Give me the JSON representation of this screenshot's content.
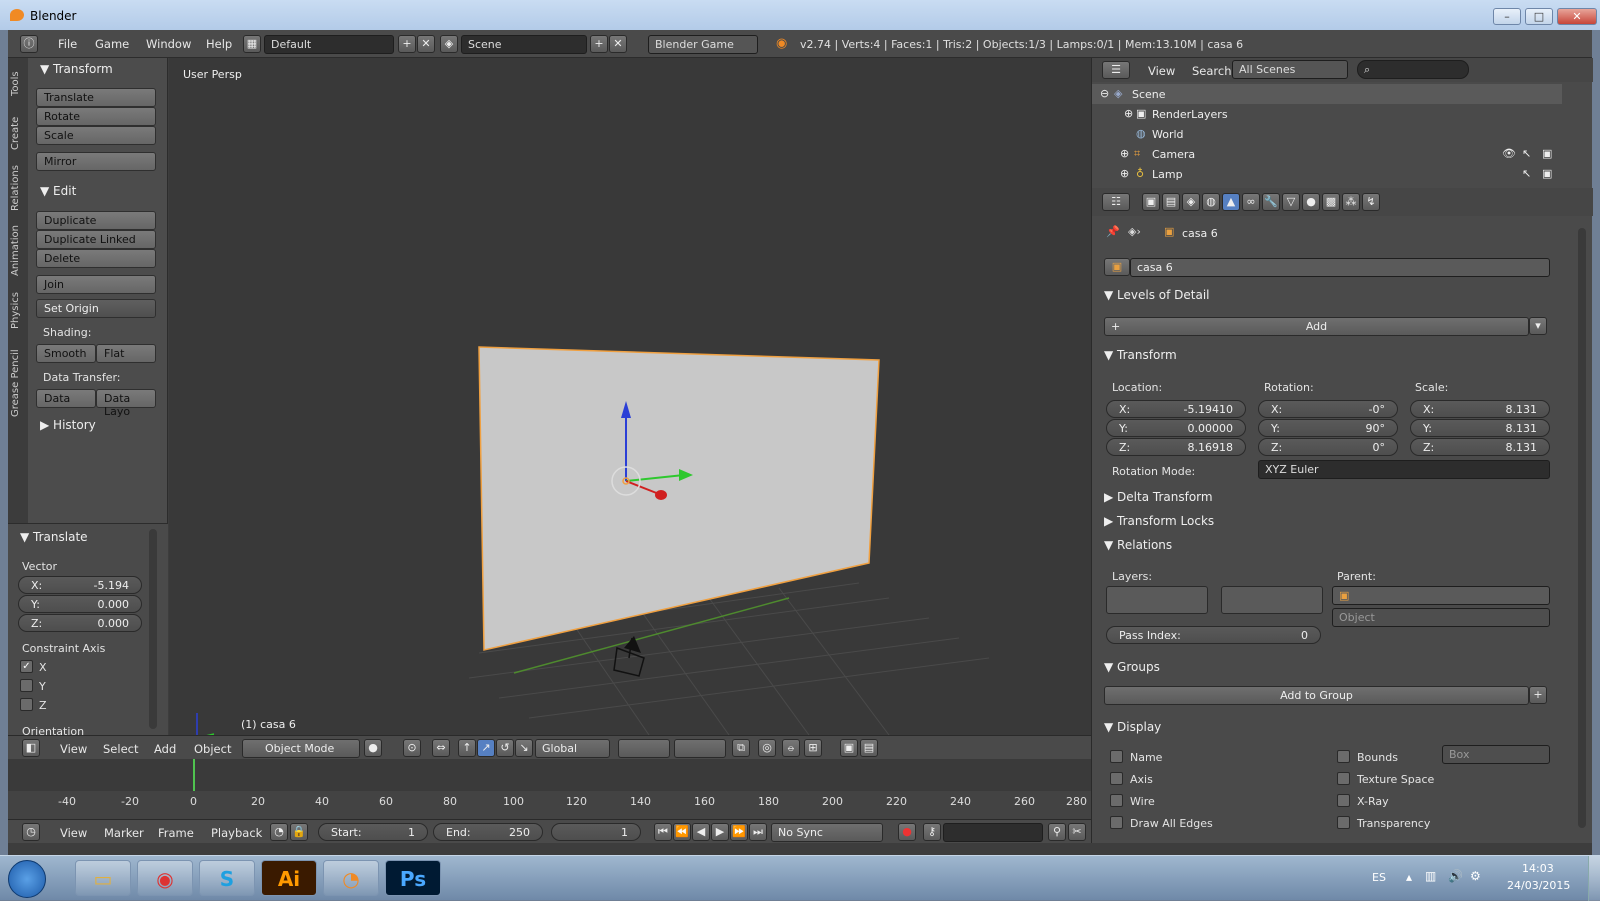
{
  "window": {
    "title": "Blender",
    "minimize": "–",
    "maximize": "□",
    "close": "✕"
  },
  "topbar": {
    "menus": [
      "File",
      "Game",
      "Window",
      "Help"
    ],
    "layout": "Default",
    "scene": "Scene",
    "engine": "Blender Game",
    "stats": "v2.74 | Verts:4 | Faces:1 | Tris:2 | Objects:1/3 | Lamps:0/1 | Mem:13.10M | casa 6"
  },
  "toolshelf": {
    "tabs": [
      "Tools",
      "Create",
      "Relations",
      "Animation",
      "Physics",
      "Grease Pencil"
    ],
    "transform_title": "Transform",
    "transform_buttons": [
      "Translate",
      "Rotate",
      "Scale"
    ],
    "mirror": "Mirror",
    "edit_title": "Edit",
    "edit_buttons": [
      "Duplicate",
      "Duplicate Linked",
      "Delete"
    ],
    "join": "Join",
    "set_origin": "Set Origin",
    "shading_label": "Shading:",
    "smooth": "Smooth",
    "flat": "Flat",
    "data_transfer_label": "Data Transfer:",
    "data": "Data",
    "data_layo": "Data Layo",
    "history_title": "History"
  },
  "operator": {
    "title": "Translate",
    "vector_label": "Vector",
    "x": "X:",
    "x_val": "-5.194",
    "y": "Y:",
    "y_val": "0.000",
    "z": "Z:",
    "z_val": "0.000",
    "constraint_label": "Constraint Axis",
    "cx": "X",
    "cy": "Y",
    "cz": "Z",
    "orientation_label": "Orientation"
  },
  "viewport": {
    "view_name": "User Persp",
    "object_label": "(1) casa 6"
  },
  "vpheader": {
    "menus": [
      "View",
      "Select",
      "Add",
      "Object"
    ],
    "mode": "Object Mode",
    "orientation": "Global"
  },
  "timeline": {
    "ticks": [
      "-40",
      "-20",
      "0",
      "20",
      "40",
      "60",
      "80",
      "100",
      "120",
      "140",
      "160",
      "180",
      "200",
      "220",
      "240",
      "260",
      "280"
    ],
    "menus": [
      "View",
      "Marker",
      "Frame",
      "Playback"
    ],
    "start_label": "Start:",
    "start": "1",
    "end_label": "End:",
    "end": "250",
    "current": "1",
    "sync": "No Sync"
  },
  "outliner": {
    "menus": [
      "View",
      "Search"
    ],
    "filter": "All Scenes",
    "rows": [
      "Scene",
      "RenderLayers",
      "World",
      "Camera",
      "Lamp"
    ]
  },
  "properties": {
    "breadcrumb": "casa 6",
    "object_name": "casa 6",
    "lod_title": "Levels of Detail",
    "add": "Add",
    "transform_title": "Transform",
    "location_label": "Location:",
    "rotation_label": "Rotation:",
    "scale_label": "Scale:",
    "loc": {
      "x": "-5.19410",
      "y": "0.00000",
      "z": "8.16918"
    },
    "rot": {
      "x": "-0°",
      "y": "90°",
      "z": "0°"
    },
    "scl": {
      "x": "8.131",
      "y": "8.131",
      "z": "8.131"
    },
    "x": "X:",
    "y": "Y:",
    "z": "Z:",
    "rotation_mode_label": "Rotation Mode:",
    "rotation_mode": "XYZ Euler",
    "delta_title": "Delta Transform",
    "locks_title": "Transform Locks",
    "relations_title": "Relations",
    "layers_label": "Layers:",
    "parent_label": "Parent:",
    "parent_type": "Object",
    "pass_index_label": "Pass Index:",
    "pass_index": "0",
    "groups_title": "Groups",
    "add_to_group": "Add to Group",
    "display_title": "Display",
    "name": "Name",
    "axis": "Axis",
    "wire": "Wire",
    "draw_all_edges": "Draw All Edges",
    "bounds": "Bounds",
    "bounds_type": "Box",
    "texture_space": "Texture Space",
    "xray": "X-Ray",
    "transparency": "Transparency"
  },
  "taskbar": {
    "lang": "ES",
    "time": "14:03",
    "date": "24/03/2015",
    "ai": "Ai",
    "ps": "Ps",
    "skype": "S"
  }
}
